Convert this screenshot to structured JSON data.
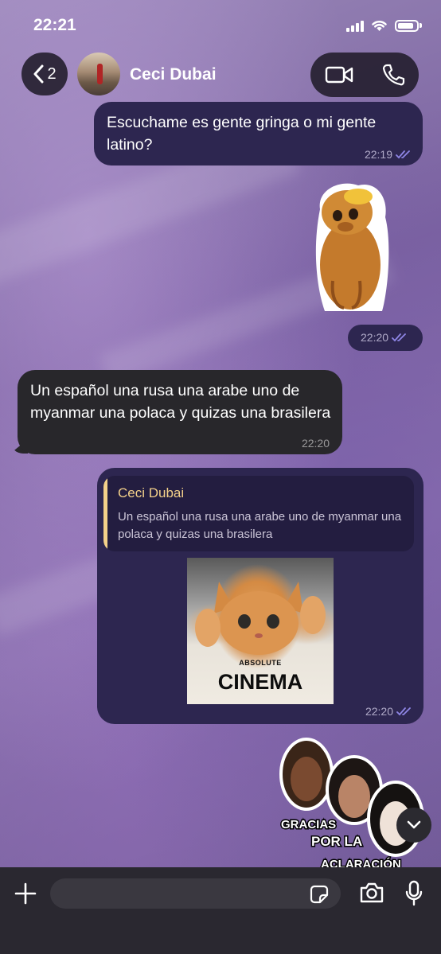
{
  "status_bar": {
    "time": "22:21"
  },
  "header": {
    "back_count": "2",
    "contact_name": "Ceci Dubai"
  },
  "messages": {
    "m1": {
      "text": "Escuchame es gente gringa o mi gente latino?",
      "time": "22:19"
    },
    "sticker1": {
      "time": "22:20"
    },
    "m2": {
      "text": "Un español una rusa una arabe uno de myanmar una polaca y quizas una brasilera",
      "time": "22:20"
    },
    "m3": {
      "reply_name": "Ceci Dubai",
      "reply_text": "Un español una rusa una arabe uno de myanmar una polaca y quizas una brasilera",
      "image_small": "ABSOLUTE",
      "image_big": "CINEMA",
      "time": "22:20"
    },
    "sticker2": {
      "line1": "GRACIAS",
      "line2": "POR LA",
      "line3": "ACLARACIÓN"
    }
  },
  "input": {
    "placeholder": ""
  },
  "colors": {
    "outgoing": "#2d2650",
    "incoming": "#28272b",
    "reply_accent": "#f4d18a",
    "read_check": "#8f86e6"
  }
}
